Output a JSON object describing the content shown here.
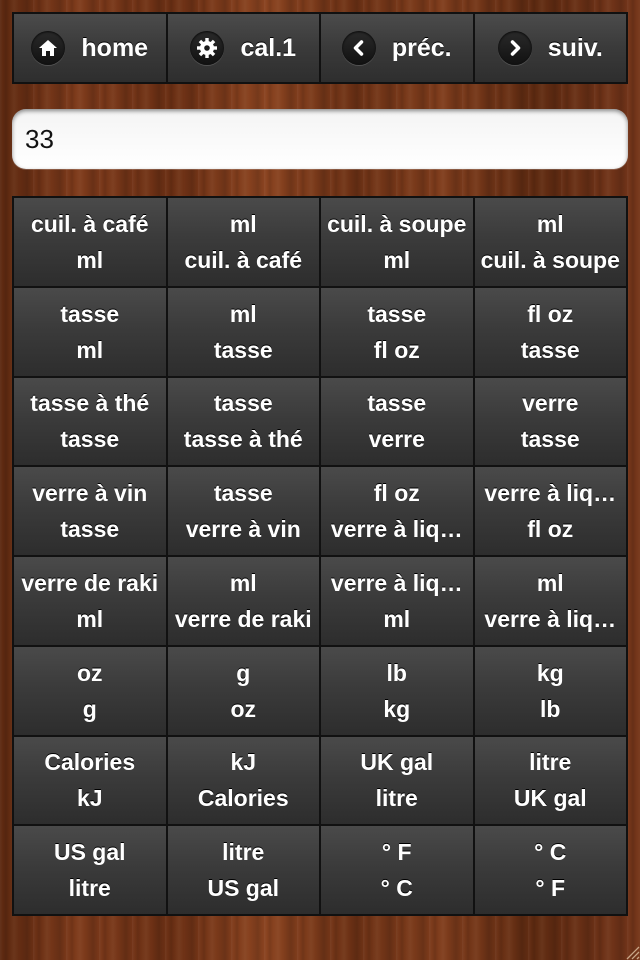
{
  "toolbar": {
    "buttons": [
      {
        "label": "home",
        "icon": "home-icon"
      },
      {
        "label": "cal.1",
        "icon": "gear-icon"
      },
      {
        "label": "préc.",
        "icon": "chevron-left-icon"
      },
      {
        "label": "suiv.",
        "icon": "chevron-right-icon"
      }
    ]
  },
  "input": {
    "value": "33"
  },
  "conversions": [
    {
      "from": "cuil. à café",
      "to": "ml"
    },
    {
      "from": "ml",
      "to": "cuil. à café"
    },
    {
      "from": "cuil. à soupe",
      "to": "ml"
    },
    {
      "from": "ml",
      "to": "cuil. à soupe"
    },
    {
      "from": "tasse",
      "to": "ml"
    },
    {
      "from": "ml",
      "to": "tasse"
    },
    {
      "from": "tasse",
      "to": "fl oz"
    },
    {
      "from": "fl oz",
      "to": "tasse"
    },
    {
      "from": "tasse à thé",
      "to": "tasse"
    },
    {
      "from": "tasse",
      "to": "tasse à thé"
    },
    {
      "from": "tasse",
      "to": "verre"
    },
    {
      "from": "verre",
      "to": "tasse"
    },
    {
      "from": "verre à vin",
      "to": "tasse"
    },
    {
      "from": "tasse",
      "to": "verre à vin"
    },
    {
      "from": "fl oz",
      "to": "verre à liq…"
    },
    {
      "from": "verre à liq…",
      "to": "fl oz"
    },
    {
      "from": "verre de raki",
      "to": "ml"
    },
    {
      "from": "ml",
      "to": "verre de raki"
    },
    {
      "from": "verre à liq…",
      "to": "ml"
    },
    {
      "from": "ml",
      "to": "verre à liq…"
    },
    {
      "from": "oz",
      "to": "g"
    },
    {
      "from": "g",
      "to": "oz"
    },
    {
      "from": "lb",
      "to": "kg"
    },
    {
      "from": "kg",
      "to": "lb"
    },
    {
      "from": "Calories",
      "to": "kJ"
    },
    {
      "from": "kJ",
      "to": "Calories"
    },
    {
      "from": "UK gal",
      "to": "litre"
    },
    {
      "from": "litre",
      "to": "UK gal"
    },
    {
      "from": "US gal",
      "to": "litre"
    },
    {
      "from": "litre",
      "to": "US gal"
    },
    {
      "from": "° F",
      "to": "° C"
    },
    {
      "from": "° C",
      "to": "° F"
    }
  ]
}
